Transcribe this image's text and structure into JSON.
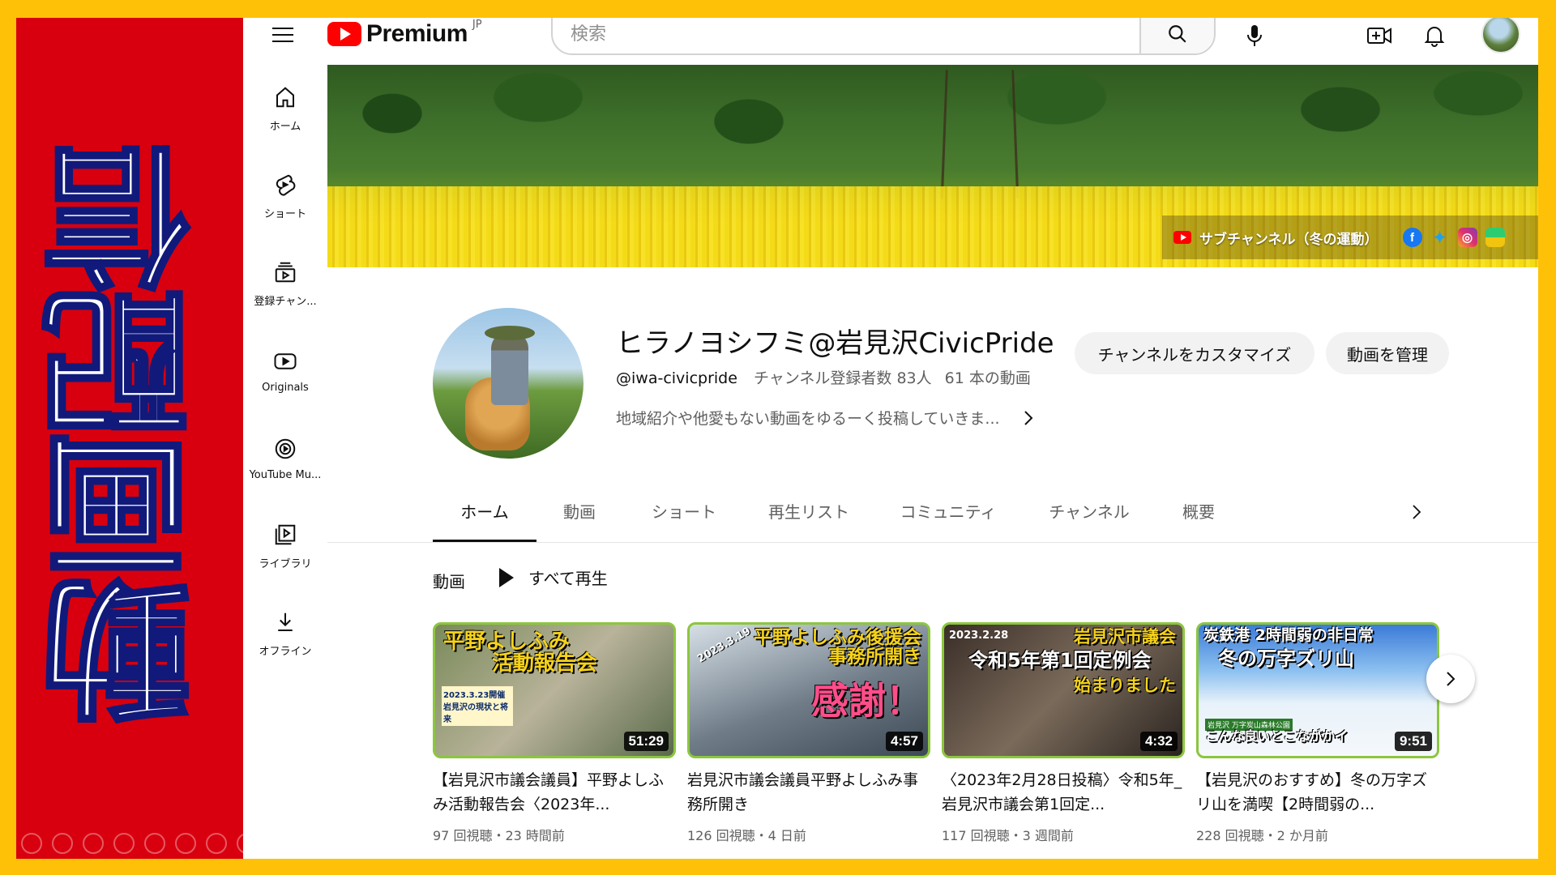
{
  "overlay": {
    "banner_text": "動画配信"
  },
  "header": {
    "logo_text": "Premium",
    "logo_region": "JP",
    "search_placeholder": "検索"
  },
  "guide": {
    "items": [
      {
        "label": "ホーム",
        "icon": "home-icon"
      },
      {
        "label": "ショート",
        "icon": "shorts-icon"
      },
      {
        "label": "登録チャン...",
        "icon": "subscriptions-icon"
      },
      {
        "label": "Originals",
        "icon": "originals-icon"
      },
      {
        "label": "YouTube Mu...",
        "icon": "music-icon"
      },
      {
        "label": "ライブラリ",
        "icon": "library-icon"
      },
      {
        "label": "オフライン",
        "icon": "download-icon"
      }
    ]
  },
  "channel_banner": {
    "link_text": "サブチャンネル（冬の運動）"
  },
  "channel": {
    "name": "ヒラノヨシフミ@岩見沢CivicPride",
    "handle": "@iwa-civicpride",
    "subscribers": "チャンネル登録者数 83人",
    "video_count": "61 本の動画",
    "description": "地域紹介や他愛もない動画をゆるーく投稿していきま...",
    "customize_label": "チャンネルをカスタマイズ",
    "manage_label": "動画を管理"
  },
  "tabs": [
    {
      "label": "ホーム",
      "active": true
    },
    {
      "label": "動画",
      "active": false
    },
    {
      "label": "ショート",
      "active": false
    },
    {
      "label": "再生リスト",
      "active": false
    },
    {
      "label": "コミュニティ",
      "active": false
    },
    {
      "label": "チャンネル",
      "active": false
    },
    {
      "label": "概要",
      "active": false
    }
  ],
  "shelf": {
    "title": "動画",
    "play_all": "すべて再生",
    "videos": [
      {
        "thumb_lines": [
          "平野よしふみ",
          "活動報告会"
        ],
        "thumb_sub": "2023.3.23開催 岩見沢の現状と将来",
        "duration": "51:29",
        "title": "【岩見沢市議会議員】平野よしふみ活動報告会〈2023年...",
        "meta": "97 回視聴・23 時間前"
      },
      {
        "thumb_lines": [
          "平野よしふみ後援会",
          "事務所開き",
          "感謝！"
        ],
        "thumb_sub": "2023.3.19",
        "duration": "4:57",
        "title": "岩見沢市議会議員平野よしふみ事務所開き",
        "meta": "126 回視聴・4 日前"
      },
      {
        "thumb_lines": [
          "岩見沢市議会",
          "令和5年第1回定例会",
          "始まりました"
        ],
        "thumb_sub": "2023.2.28",
        "duration": "4:32",
        "title": "〈2023年2月28日投稿〉令和5年_岩見沢市議会第1回定...",
        "meta": "117 回視聴・3 週間前"
      },
      {
        "thumb_lines": [
          "炭鉄港 2時間弱の非日常",
          "冬の万字ズリ山",
          "こんな良いとこながかイ"
        ],
        "thumb_sub": "岩見沢 万字炭山森林公園",
        "duration": "9:51",
        "title": "【岩見沢のおすすめ】冬の万字ズリ山を満喫【2時間弱の...",
        "meta": "228 回視聴・2 か月前"
      }
    ]
  }
}
